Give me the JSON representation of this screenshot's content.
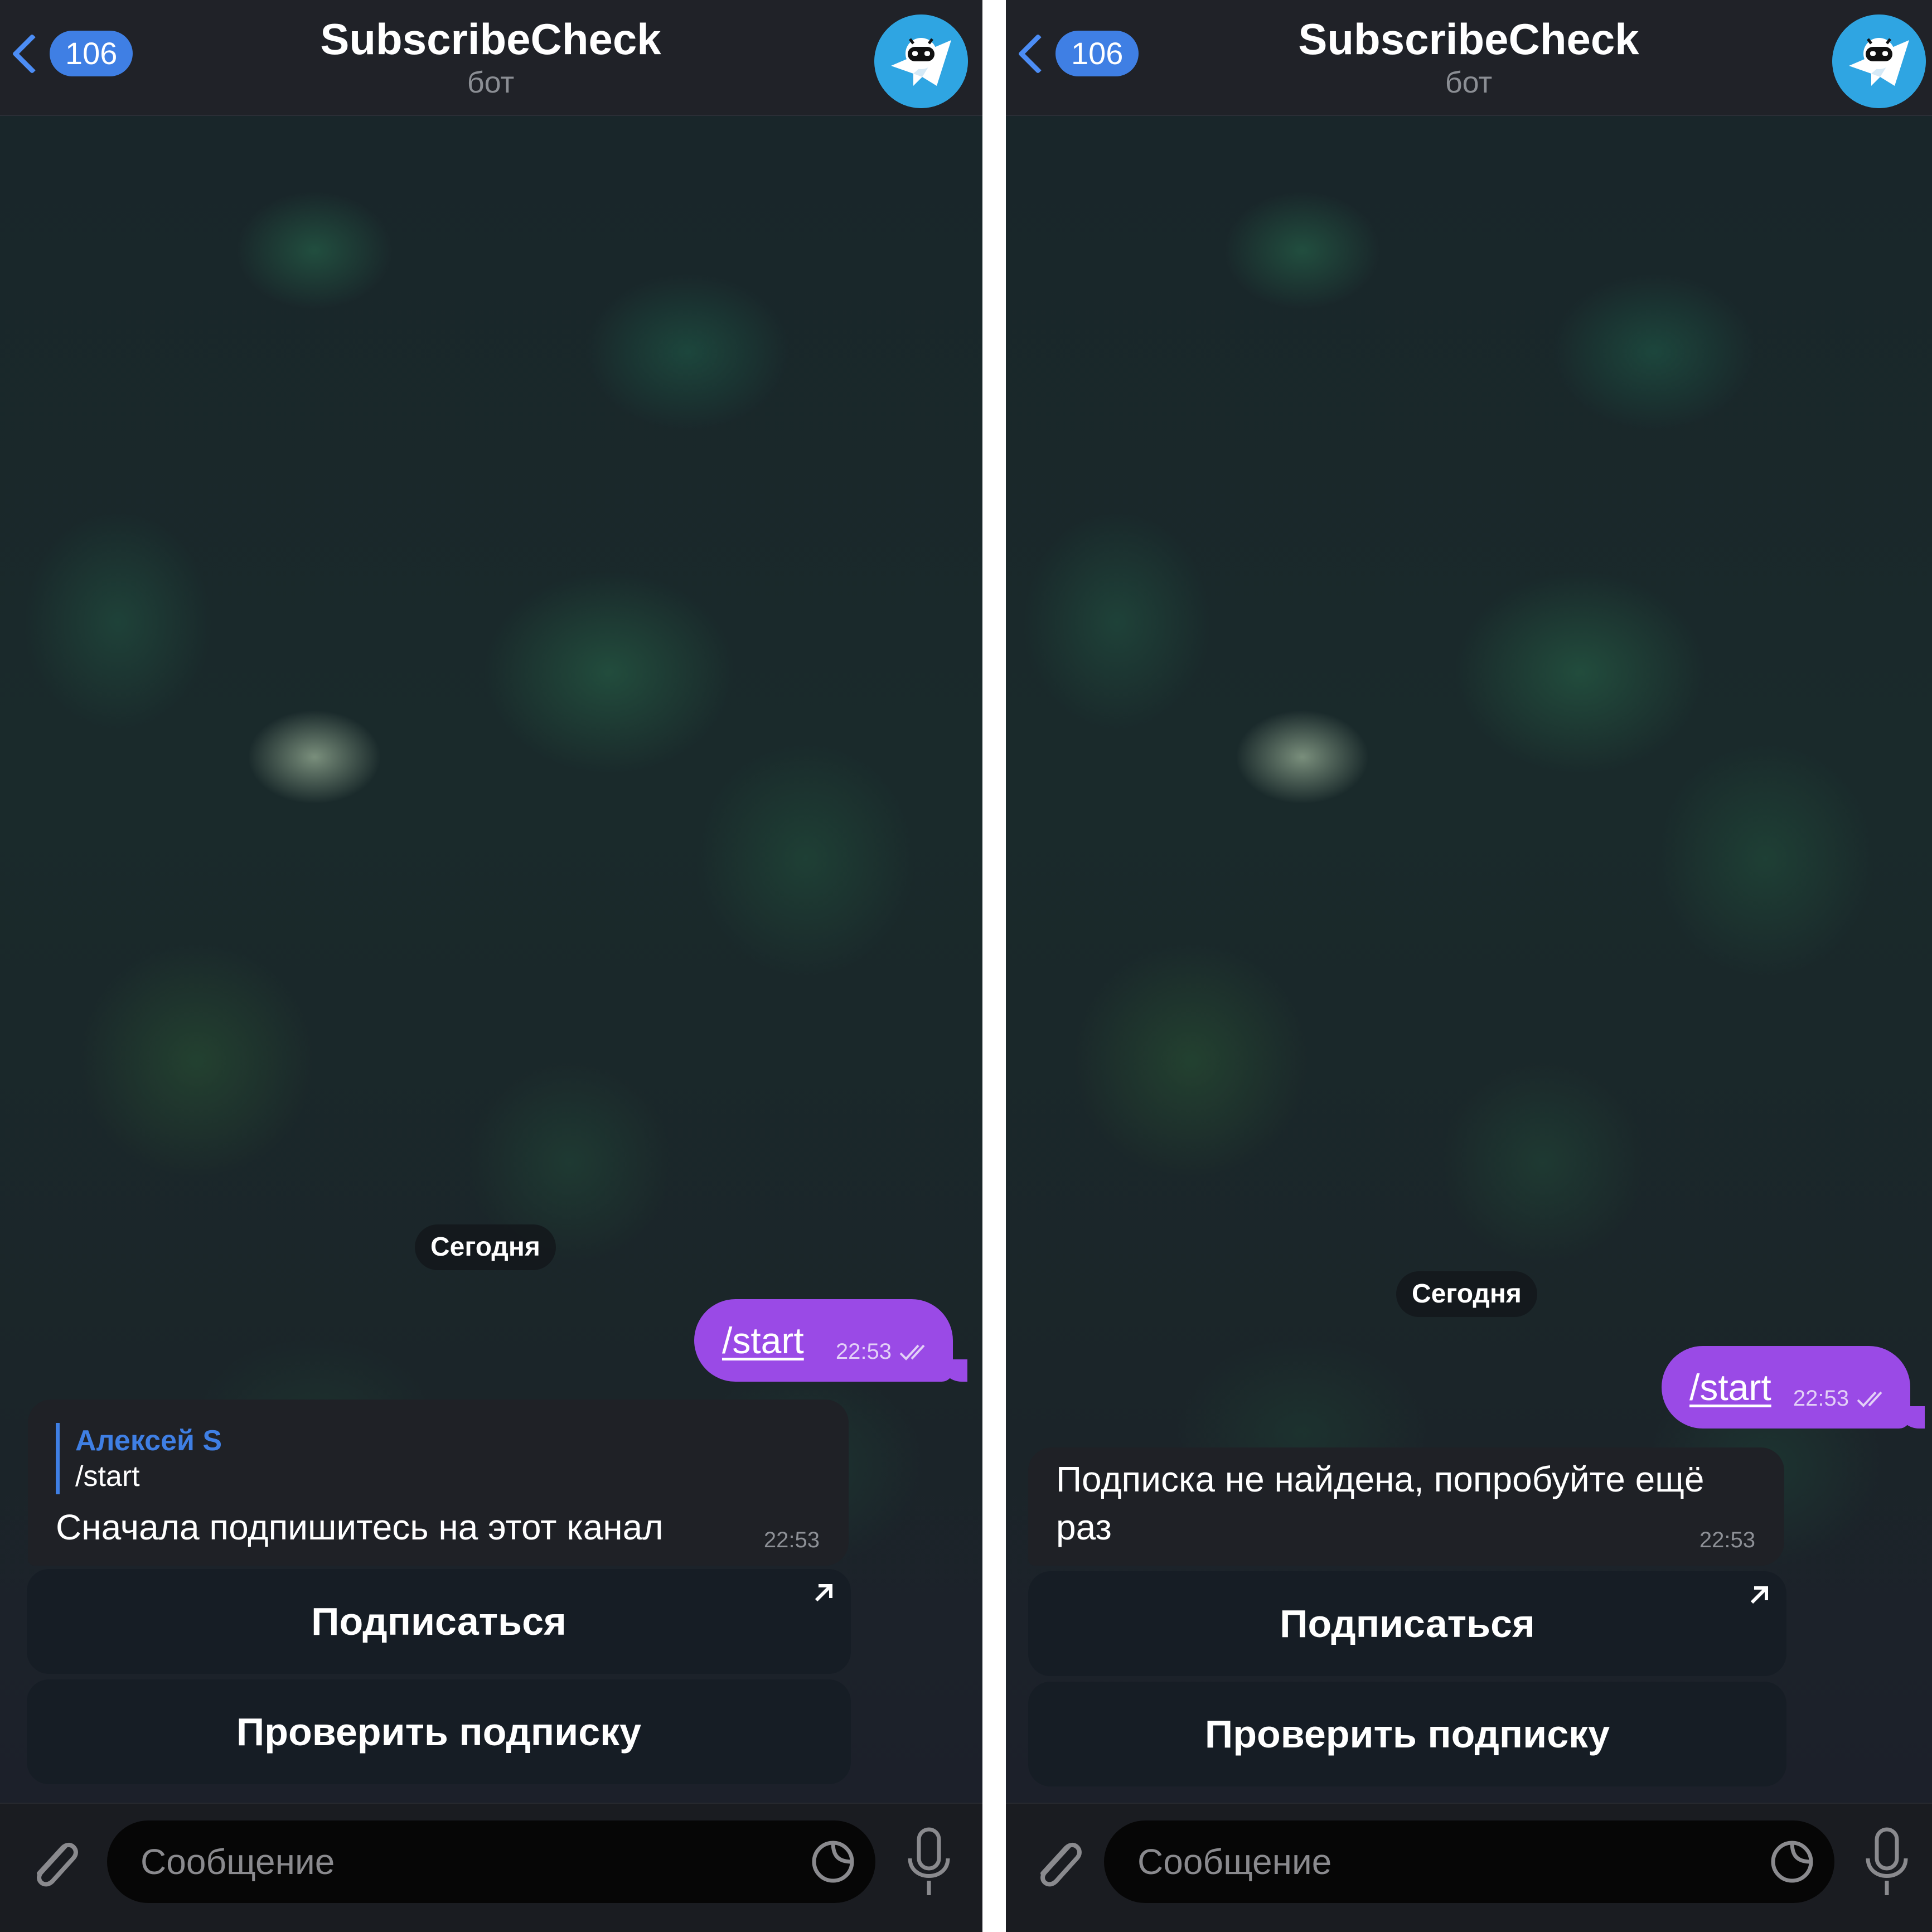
{
  "colors": {
    "accent": "#3f7fe4",
    "outgoing_bubble": "#9a4ae6",
    "incoming_bubble": "#1f2126",
    "header_bg": "#202228",
    "avatar_bg": "#2fa5e2"
  },
  "screens": [
    {
      "header": {
        "back_count": "106",
        "title": "SubscribeCheck",
        "subtitle": "бот"
      },
      "date_label": "Сегодня",
      "outgoing": {
        "text": "/start",
        "time": "22:53"
      },
      "incoming": {
        "reply_author": "Алексей S",
        "reply_text": "/start",
        "text": "Сначала подпишитесь на этот канал",
        "time": "22:53"
      },
      "buttons": [
        {
          "label": "Подписаться",
          "icon": "external-link-arrow-icon"
        },
        {
          "label": "Проверить подписку"
        }
      ],
      "input": {
        "placeholder": "Сообщение"
      }
    },
    {
      "header": {
        "back_count": "106",
        "title": "SubscribeCheck",
        "subtitle": "бот"
      },
      "date_label": "Сегодня",
      "outgoing": {
        "text": "/start",
        "time": "22:53"
      },
      "incoming": {
        "text_line1": "Подписка не найдена, попробуйте ещё",
        "text_line2": "раз",
        "time": "22:53"
      },
      "buttons": [
        {
          "label": "Подписаться",
          "icon": "external-link-arrow-icon"
        },
        {
          "label": "Проверить подписку"
        }
      ],
      "input": {
        "placeholder": "Сообщение"
      }
    }
  ]
}
